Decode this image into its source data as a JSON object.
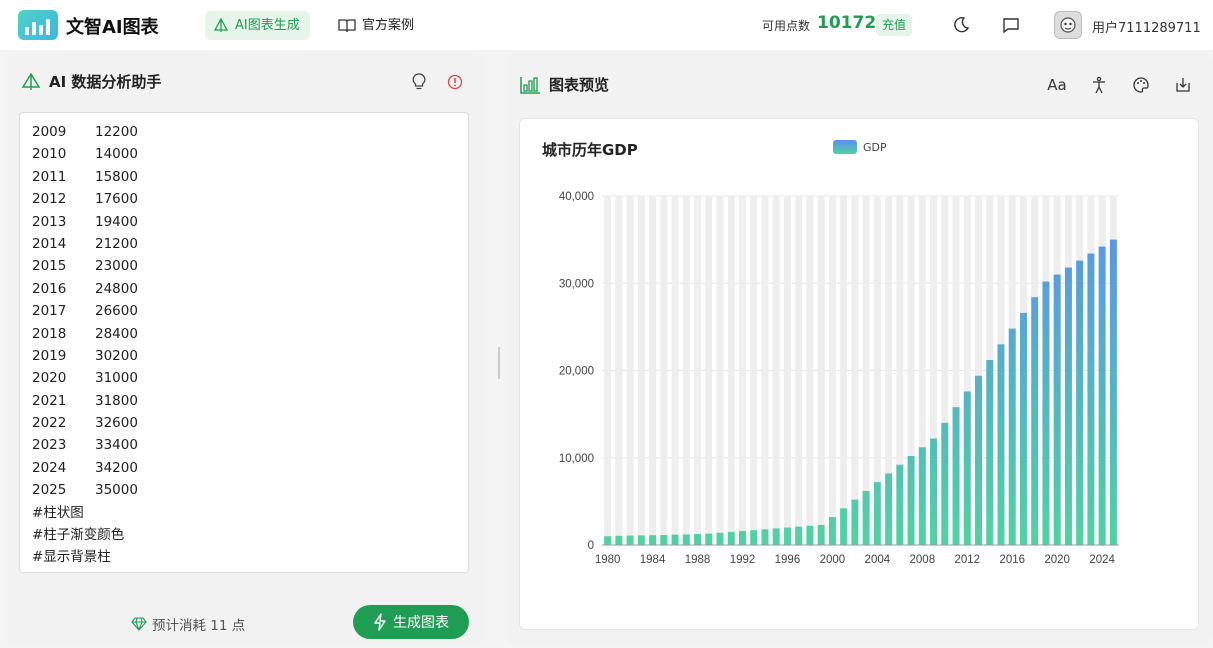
{
  "header": {
    "app_title": "文智AI图表",
    "nav_ai": "AI图表生成",
    "nav_case": "官方案例",
    "points_label": "可用点数",
    "points_value": "10172",
    "recharge": "充值",
    "username": "用户7111289711"
  },
  "left": {
    "title": "AI 数据分析助手",
    "rows": [
      {
        "year": "2009",
        "value": "12200"
      },
      {
        "year": "2010",
        "value": "14000"
      },
      {
        "year": "2011",
        "value": "15800"
      },
      {
        "year": "2012",
        "value": "17600"
      },
      {
        "year": "2013",
        "value": "19400"
      },
      {
        "year": "2014",
        "value": "21200"
      },
      {
        "year": "2015",
        "value": "23000"
      },
      {
        "year": "2016",
        "value": "24800"
      },
      {
        "year": "2017",
        "value": "26600"
      },
      {
        "year": "2018",
        "value": "28400"
      },
      {
        "year": "2019",
        "value": "30200"
      },
      {
        "year": "2020",
        "value": "31000"
      },
      {
        "year": "2021",
        "value": "31800"
      },
      {
        "year": "2022",
        "value": "32600"
      },
      {
        "year": "2023",
        "value": "33400"
      },
      {
        "year": "2024",
        "value": "34200"
      },
      {
        "year": "2025",
        "value": "35000"
      }
    ],
    "tags": [
      "#柱状图",
      "#柱子渐变颜色",
      "#显示背景柱"
    ],
    "cost_text": "预计消耗 11 点",
    "generate_label": "生成图表"
  },
  "right": {
    "title": "图表预览",
    "font_icon_text": "Aa"
  },
  "chart_data": {
    "type": "bar",
    "title": "城市历年GDP",
    "legend": [
      "GDP"
    ],
    "legend_position": "top-center",
    "xlabel": "",
    "ylabel": "",
    "ylim": [
      0,
      40000
    ],
    "yticks": [
      "0",
      "10,000",
      "20,000",
      "30,000",
      "40,000"
    ],
    "xticks": [
      "1980",
      "1984",
      "1988",
      "1992",
      "1996",
      "2000",
      "2004",
      "2008",
      "2012",
      "2016",
      "2020",
      "2024"
    ],
    "background_bars": true,
    "gradient_colors": [
      "#5b8ff0",
      "#4fd3a0"
    ],
    "categories": [
      "1980",
      "1981",
      "1982",
      "1983",
      "1984",
      "1985",
      "1986",
      "1987",
      "1988",
      "1989",
      "1990",
      "1991",
      "1992",
      "1993",
      "1994",
      "1995",
      "1996",
      "1997",
      "1998",
      "1999",
      "2000",
      "2001",
      "2002",
      "2003",
      "2004",
      "2005",
      "2006",
      "2007",
      "2008",
      "2009",
      "2010",
      "2011",
      "2012",
      "2013",
      "2014",
      "2015",
      "2016",
      "2017",
      "2018",
      "2019",
      "2020",
      "2021",
      "2022",
      "2023",
      "2024",
      "2025"
    ],
    "series": [
      {
        "name": "GDP",
        "values": [
          1000,
          1050,
          1080,
          1100,
          1120,
          1150,
          1180,
          1200,
          1250,
          1300,
          1400,
          1500,
          1600,
          1700,
          1800,
          1900,
          2000,
          2100,
          2200,
          2300,
          3200,
          4200,
          5200,
          6200,
          7200,
          8200,
          9200,
          10200,
          11200,
          12200,
          14000,
          15800,
          17600,
          19400,
          21200,
          23000,
          24800,
          26600,
          28400,
          30200,
          31000,
          31800,
          32600,
          33400,
          34200,
          35000
        ]
      }
    ]
  }
}
